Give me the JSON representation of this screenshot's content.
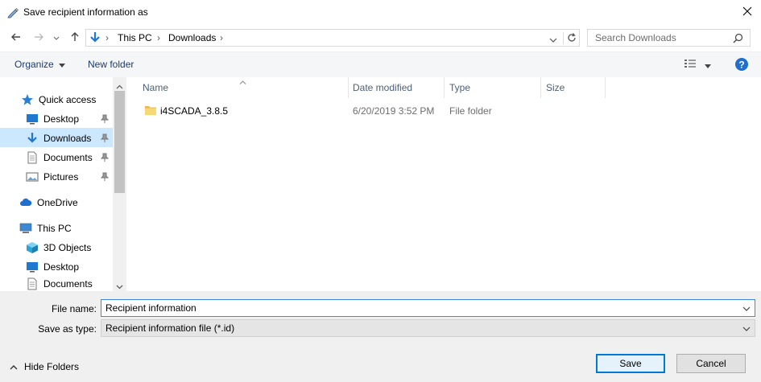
{
  "window": {
    "title": "Save recipient information as"
  },
  "address": {
    "path": [
      "This PC",
      "Downloads"
    ],
    "search_placeholder": "Search Downloads"
  },
  "toolbar": {
    "organize_label": "Organize",
    "new_folder_label": "New folder"
  },
  "nav": {
    "items": [
      {
        "label": "Quick access",
        "icon": "star-icon"
      },
      {
        "label": "Desktop",
        "icon": "desktop-icon",
        "pinned": true
      },
      {
        "label": "Downloads",
        "icon": "download-icon",
        "pinned": true,
        "selected": true
      },
      {
        "label": "Documents",
        "icon": "document-icon",
        "pinned": true
      },
      {
        "label": "Pictures",
        "icon": "pictures-icon",
        "pinned": true
      },
      {
        "label": "OneDrive",
        "icon": "cloud-icon"
      },
      {
        "label": "This PC",
        "icon": "computer-icon"
      },
      {
        "label": "3D Objects",
        "icon": "cube-icon"
      },
      {
        "label": "Desktop",
        "icon": "desktop-icon"
      },
      {
        "label": "Documents",
        "icon": "document-icon"
      }
    ]
  },
  "filelist": {
    "columns": [
      "Name",
      "Date modified",
      "Type",
      "Size"
    ],
    "rows": [
      {
        "name": "i4SCADA_3.8.5",
        "date": "6/20/2019 3:52 PM",
        "type": "File folder",
        "size": ""
      }
    ]
  },
  "form": {
    "filename_label": "File name:",
    "filename_value": "Recipient information",
    "savetype_label": "Save as type:",
    "savetype_value": "Recipient information file (*.id)"
  },
  "footer": {
    "hide_folders_label": "Hide Folders",
    "save_label": "Save",
    "cancel_label": "Cancel"
  },
  "colors": {
    "accent": "#0078d7",
    "selection": "#cce8ff",
    "folder": "#f8d775"
  }
}
